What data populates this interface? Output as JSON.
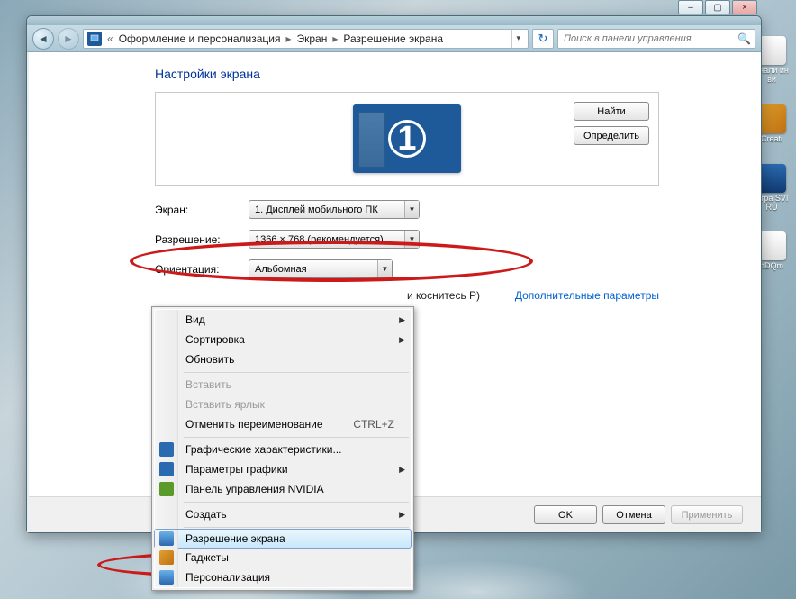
{
  "win_controls": {
    "min": "–",
    "max": "▢",
    "close": "×"
  },
  "breadcrumb": {
    "seg1": "Оформление и персонализация",
    "seg2": "Экран",
    "seg3": "Разрешение экрана"
  },
  "search": {
    "placeholder": "Поиск в панели управления"
  },
  "heading": "Настройки экрана",
  "monitor_number": "1",
  "buttons": {
    "find": "Найти",
    "detect": "Определить",
    "ok": "OK",
    "cancel": "Отмена",
    "apply": "Применить"
  },
  "labels": {
    "screen": "Экран:",
    "resolution": "Разрешение:",
    "orientation": "Ориентация:"
  },
  "selects": {
    "screen": "1. Дисплей мобильного ПК",
    "resolution": "1366 × 768 (рекомендуется)",
    "orientation": "Альбомная"
  },
  "advanced_link": "Дополнительные параметры",
  "hint_fragment": "и коснитесь P)",
  "context_menu": {
    "view": "Вид",
    "sort": "Сортировка",
    "refresh": "Обновить",
    "paste": "Вставить",
    "paste_shortcut": "Вставить ярлык",
    "undo_rename": "Отменить переименование",
    "undo_shortcut": "CTRL+Z",
    "gfx_props": "Графические характеристики...",
    "gfx_params": "Параметры графики",
    "nvidia_panel": "Панель управления NVIDIA",
    "create": "Создать",
    "resolution": "Разрешение экрана",
    "gadgets": "Гаджеты",
    "personalize": "Персонализация"
  },
  "desktop": {
    "item1": "анали\nинви",
    "item2": "Creati",
    "item3": "Игра\nSVIRU",
    "item4": "pDQm"
  }
}
